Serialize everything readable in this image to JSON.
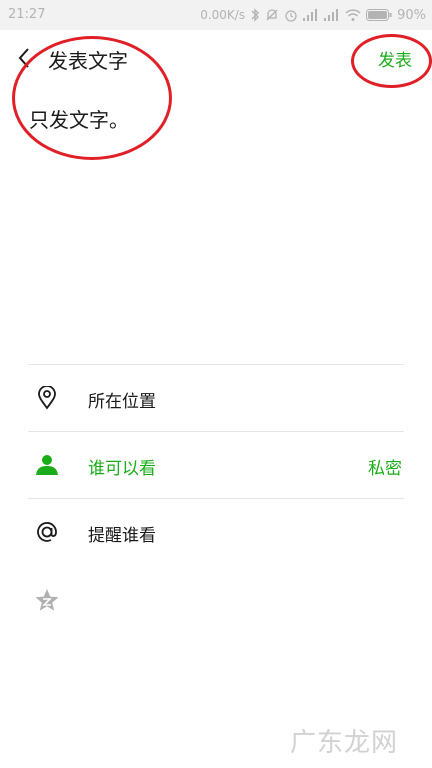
{
  "status_bar": {
    "time": "21:27",
    "net_speed": "0.00K/s",
    "battery": "90%"
  },
  "header": {
    "title": "发表文字",
    "publish_label": "发表"
  },
  "post": {
    "text": "只发文字。"
  },
  "options": {
    "location_label": "所在位置",
    "visibility_label": "谁可以看",
    "visibility_value": "私密",
    "remind_label": "提醒谁看"
  },
  "watermark": {
    "text": "广东龙网"
  },
  "colors": {
    "accent": "#1aad19",
    "annotation": "#e01f26",
    "status_text": "#b3b3b3"
  },
  "icons": {
    "back": "chevron-left-icon",
    "location": "location-pin-icon",
    "visibility": "person-icon",
    "remind": "at-sign-icon",
    "star": "star-icon"
  }
}
